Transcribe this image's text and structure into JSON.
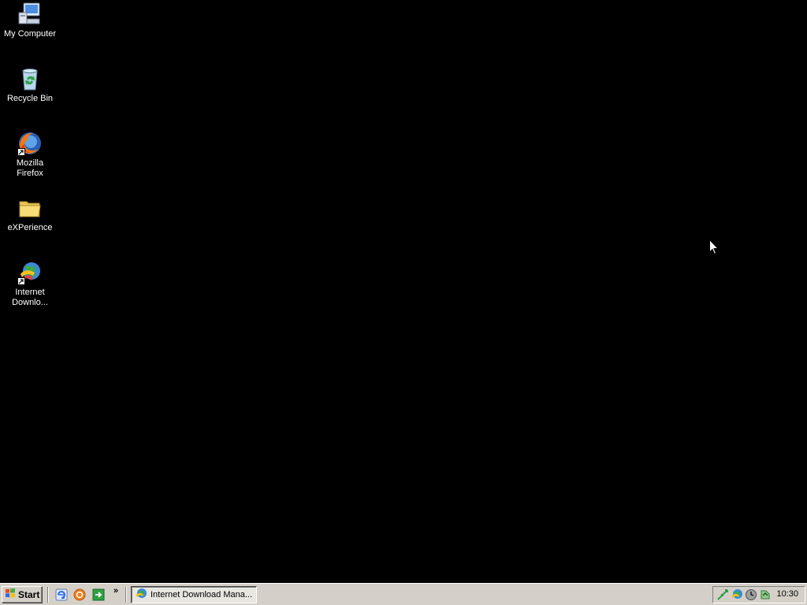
{
  "desktop": {
    "icons": [
      {
        "label": "My Computer",
        "icon": "my-computer-icon"
      },
      {
        "label": "Recycle Bin",
        "icon": "recycle-bin-icon"
      },
      {
        "label": "Mozilla Firefox",
        "icon": "firefox-icon"
      },
      {
        "label": "eXPerience",
        "icon": "folder-icon"
      },
      {
        "label": "Internet Downlo...",
        "icon": "idm-icon"
      }
    ]
  },
  "taskbar": {
    "start_label": "Start",
    "quick_launch": [
      "internet-explorer-icon",
      "browser-orange-icon",
      "show-desktop-icon"
    ],
    "overflow_label": "»",
    "task_button_label": "Internet Download Mana...",
    "tray_icons": [
      "network-icon",
      "idm-tray-icon",
      "clock-tray-icon",
      "security-tray-icon"
    ],
    "clock": "10:30"
  },
  "colors": {
    "desktop_background": "#000000",
    "taskbar": "#d4d0c8"
  }
}
